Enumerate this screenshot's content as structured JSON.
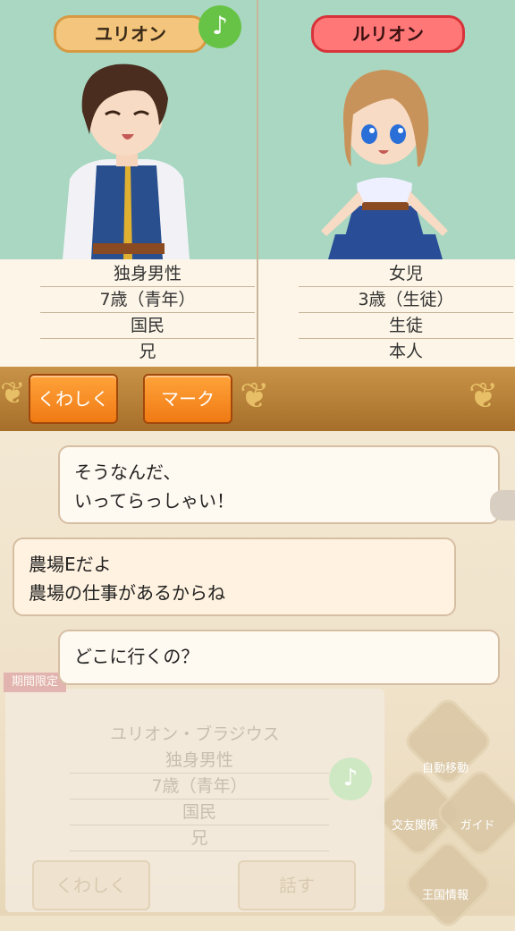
{
  "characters": {
    "left": {
      "name": "ユリオン",
      "rows": [
        "独身男性",
        "7歳（青年）",
        "国民",
        "兄"
      ]
    },
    "right": {
      "name": "ルリオン",
      "rows": [
        "女児",
        "3歳（生徒）",
        "生徒",
        "本人"
      ]
    }
  },
  "icons": {
    "music_note": "♪",
    "ornament": "❦"
  },
  "actions": {
    "detail_label": "くわしく",
    "mark_label": "マーク"
  },
  "dialogue": {
    "bubble1": [
      "そうなんだ、",
      "いってらっしゃい！"
    ],
    "bubble2": [
      "農場Eだよ",
      "農場の仕事があるからね"
    ],
    "bubble3": [
      "どこに行くの？"
    ]
  },
  "background_card": {
    "tag": "期間限定",
    "full_name": "ユリオン・ブラジウス",
    "rows": [
      "独身男性",
      "7歳（青年）",
      "国民",
      "兄"
    ],
    "detail_label": "くわしく",
    "talk_label": "話す"
  },
  "side_menu": [
    "自動移動",
    "交友関係",
    "ガイド",
    "王国情報"
  ],
  "colors": {
    "portrait_bg": "#a9d7c1",
    "left_pill": "#f4c57c",
    "right_pill": "#ff7777",
    "action_button": "#f07a14",
    "action_bar": "#b37e35"
  }
}
